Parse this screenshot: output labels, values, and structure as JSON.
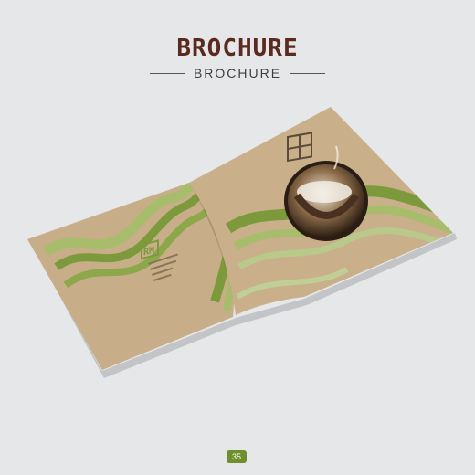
{
  "header": {
    "logo_title": "BROCHURE",
    "subtitle": "BROCHURE"
  },
  "brochure": {
    "logo_mark": "RM",
    "cover_image": "coconut-bowl-photo",
    "back_cover_text": [
      "(illegible contact text)",
      "(illegible contact text)",
      "(illegible contact text)",
      "(illegible contact text)"
    ],
    "colors": {
      "kraft": "#c8ae88",
      "wave_dark": "#7c9a3c",
      "wave_light": "#a7bd6c",
      "background": "#e6e7e9"
    }
  },
  "footer": {
    "page_number": "35"
  }
}
